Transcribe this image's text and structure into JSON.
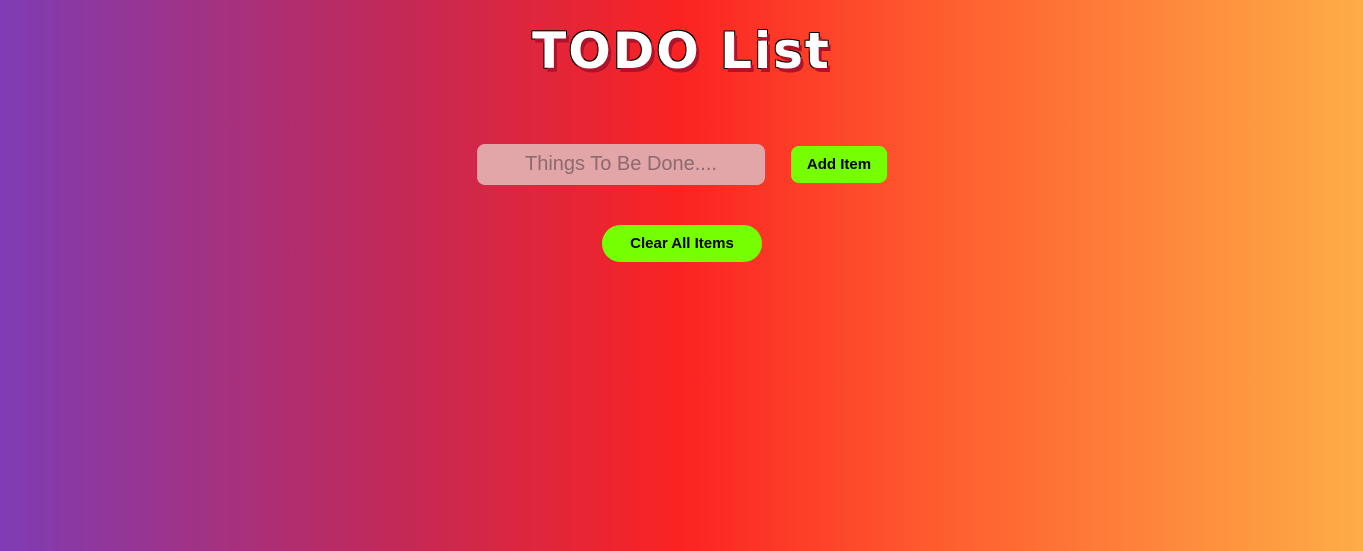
{
  "header": {
    "title": "TODO List"
  },
  "form": {
    "input_value": "",
    "input_placeholder": "Things To Be Done....",
    "add_label": "Add Item",
    "clear_label": "Clear All Items"
  },
  "colors": {
    "button_bg": "#76ff03",
    "gradient_left": "#7f3cb4",
    "gradient_mid": "#fb2322",
    "gradient_right": "#fdad47",
    "title_text": "#ffffff"
  }
}
